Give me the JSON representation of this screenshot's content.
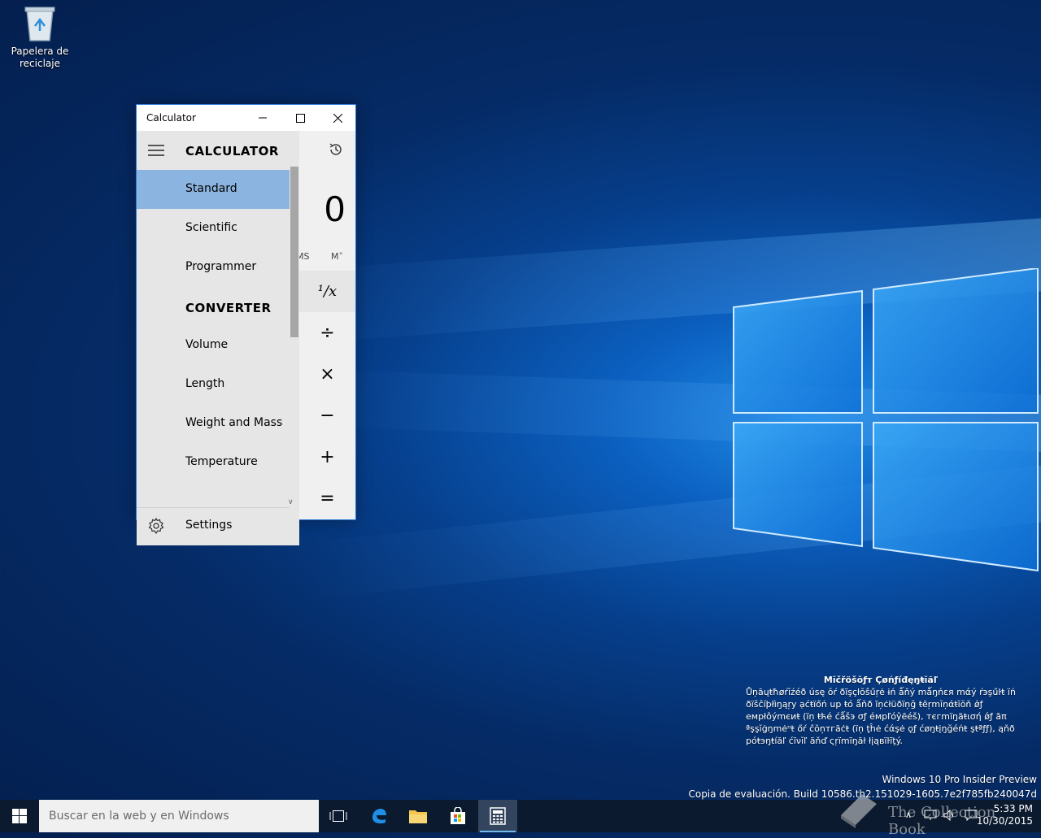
{
  "desktop": {
    "recycle_bin_label": "Papelera de reciclaje"
  },
  "calculator": {
    "window_title": "Calculator",
    "nav_title": "CALCULATOR",
    "items": [
      {
        "label": "Standard",
        "selected": true
      },
      {
        "label": "Scientific",
        "selected": false
      },
      {
        "label": "Programmer",
        "selected": false
      }
    ],
    "converter_title": "CONVERTER",
    "converter_items": [
      "Volume",
      "Length",
      "Weight and Mass",
      "Temperature"
    ],
    "settings_label": "Settings",
    "display_value": "0",
    "memory_buttons": [
      "MS",
      "M˅"
    ],
    "operators": [
      "¹/x",
      "÷",
      "×",
      "−",
      "+",
      "="
    ]
  },
  "watermark": {
    "heading": "Mĭčřöšŏƒт Çøńƒíđęŋŧĭăľ",
    "lines": [
      "Ůņāųŧħøŕĭźéð úsę ŏŕ ðïşçłŏŝűŗė ɨń ǻňý mǻŋńεя mάý ŕэşűŀŧ ïń",
      "ðïšĉíþłìŋąŗу ạćŧïőń uр ŧό ǻňð ĩņċłüðïņğ ŧēŗmĭņάŧĭŏň ǿƒ",
      "eмрłôýmєиŧ (ïņ ŧћé ćǻšэ σƒ éмрľóŷēéš), тєгmïŋäŧισή ǿƒ ãπ",
      "ªşşĭġŋmėⁿŧ őŕ ĉŏņтгăċŧ (ïņ ţĥė ćάşė ǫƒ ćøŋŧįŋğéńŧ şŧªƒƒ), ąňð",
      "рόŧэŋŧíăľ ćïνĭľ ăňď ςŗїmïŋăł łįąвïŀĩţý."
    ]
  },
  "build": {
    "line1": "Windows 10 Pro Insider Preview",
    "line2": "Copia de evaluación. Build 10586.th2.151029-1605.7e2f785fb240047d"
  },
  "taskbar": {
    "search_placeholder": "Buscar en la web y en Windows",
    "time": "5:33 PM",
    "date": "10/30/2015",
    "watermark_brand": "The Collection Book"
  }
}
